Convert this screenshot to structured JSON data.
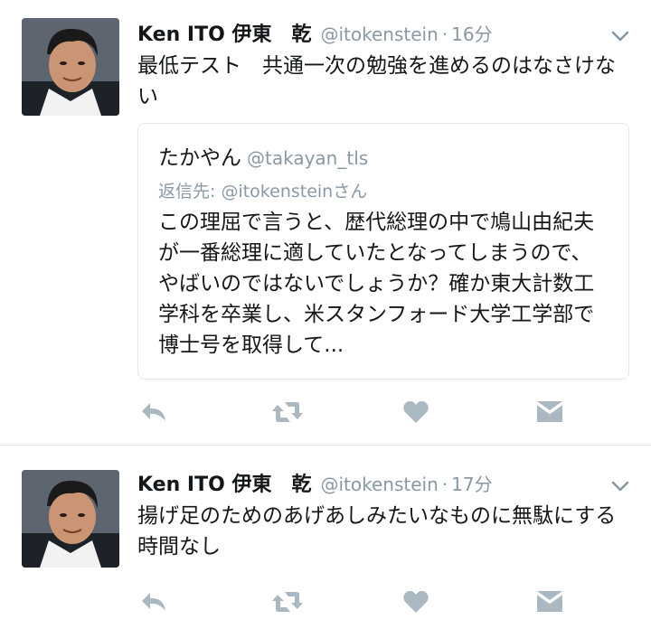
{
  "tweets": [
    {
      "name": "Ken ITO 伊東　乾",
      "handle": "@itokenstein",
      "separator": "·",
      "time": "16分",
      "text": "最低テスト　共通一次の勉強を進めるのはなさけない",
      "quoted": {
        "name": "たかやん",
        "handle": "@takayan_tls",
        "reply_prefix": "返信先: ",
        "reply_mention": "@itokenstein",
        "reply_suffix": "さん",
        "text": "この理屈で言うと、歴代総理の中で鳩山由紀夫が一番総理に適していたとなってしまうので、 やばいのではないでしょうか？確か東大計数工学科を卒業し、米スタンフォード大学工学部で博士号を取得して..."
      },
      "actions": [
        "reply-icon",
        "retweet-icon",
        "like-icon",
        "message-icon"
      ]
    },
    {
      "name": "Ken ITO 伊東　乾",
      "handle": "@itokenstein",
      "separator": "·",
      "time": "17分",
      "text": "揚げ足のためのあげあしみたいなものに無駄にする時間なし",
      "actions": [
        "reply-icon",
        "retweet-icon",
        "like-icon",
        "message-icon"
      ]
    }
  ],
  "colors": {
    "muted": "#8899a6",
    "border": "#e1e8ed",
    "text": "#14171a",
    "icon": "#aab8c2"
  }
}
